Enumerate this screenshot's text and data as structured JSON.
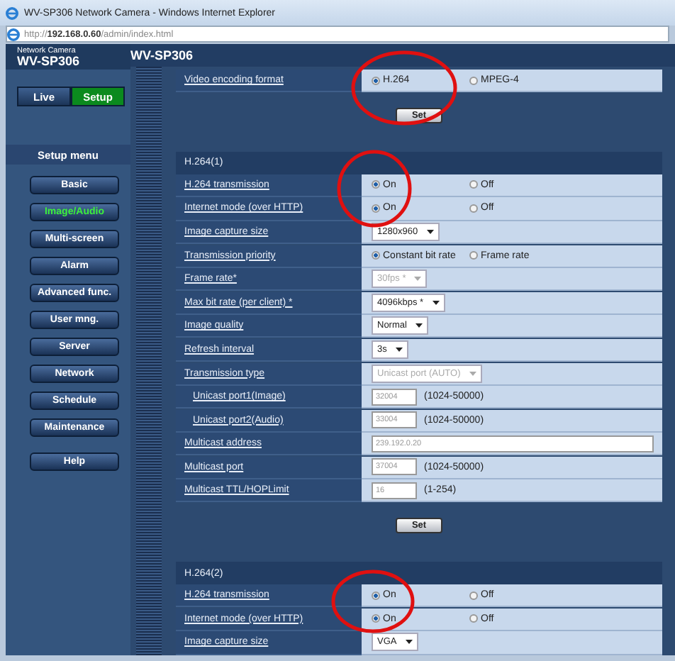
{
  "window": {
    "title": "WV-SP306 Network Camera - Windows Internet Explorer",
    "address": "http://**192.168.0.60**/admin/index.html"
  },
  "brand": {
    "subtitle": "Network Camera",
    "model": "WV-SP306"
  },
  "modes": [
    {
      "label": "Live",
      "selected": false
    },
    {
      "label": "Setup",
      "selected": true
    }
  ],
  "setup_menu": {
    "title": "Setup menu",
    "items": [
      {
        "label": "Basic",
        "selected": false
      },
      {
        "label": "Image/Audio",
        "selected": true
      },
      {
        "label": "Multi-screen",
        "selected": false
      },
      {
        "label": "Alarm",
        "selected": false
      },
      {
        "label": "Advanced func.",
        "selected": false
      },
      {
        "label": "User mng.",
        "selected": false
      },
      {
        "label": "Server",
        "selected": false
      },
      {
        "label": "Network",
        "selected": false
      },
      {
        "label": "Schedule",
        "selected": false
      },
      {
        "label": "Maintenance",
        "selected": false
      }
    ],
    "help_button": "Help"
  },
  "page_title": "WV-SP306",
  "sections": [
    {
      "rows": [
        {
          "label": "Video encoding format",
          "kind": "radio",
          "options": [
            {
              "label": "H.264",
              "selected": true
            },
            {
              "label": "MPEG-4",
              "selected": false
            }
          ]
        }
      ],
      "set_button": "Set"
    },
    {
      "title": "H.264(1)",
      "rows": [
        {
          "label": "H.264 transmission",
          "kind": "radio",
          "options": [
            {
              "label": "On",
              "selected": true
            },
            {
              "label": "Off",
              "selected": false
            }
          ]
        },
        {
          "label": "Internet mode (over HTTP)",
          "kind": "radio",
          "options": [
            {
              "label": "On",
              "selected": true
            },
            {
              "label": "Off",
              "selected": false
            }
          ]
        },
        {
          "label": "Image capture size",
          "kind": "select",
          "value": "1280x960",
          "disabled": false
        },
        {
          "label": "Transmission priority",
          "kind": "radio",
          "options": [
            {
              "label": "Constant bit rate",
              "selected": true
            },
            {
              "label": "Frame rate",
              "selected": false
            }
          ]
        },
        {
          "label": "Frame rate*",
          "kind": "select",
          "value": "30fps *",
          "disabled": true
        },
        {
          "label": "Max bit rate (per client) *",
          "kind": "select",
          "value": "4096kbps *",
          "disabled": false
        },
        {
          "label": "Image quality",
          "kind": "select",
          "value": "Normal",
          "disabled": false
        },
        {
          "label": "Refresh interval",
          "kind": "select",
          "value": "3s",
          "disabled": false
        },
        {
          "label": "Transmission type",
          "kind": "select",
          "value": "Unicast port (AUTO)",
          "disabled": true,
          "children": [
            {
              "label": "Unicast port1(Image)",
              "kind": "input",
              "value": "32004",
              "disabled": true,
              "suffix": "(1024-50000)"
            },
            {
              "label": "Unicast port2(Audio)",
              "kind": "input",
              "value": "33004",
              "disabled": true,
              "suffix": "(1024-50000)"
            }
          ]
        },
        {
          "label": "Multicast address",
          "kind": "input",
          "value": "239.192.0.20",
          "disabled": true,
          "wide": true
        },
        {
          "label": "Multicast port",
          "kind": "input",
          "value": "37004",
          "disabled": true,
          "suffix": "(1024-50000)"
        },
        {
          "label": "Multicast TTL/HOPLimit",
          "kind": "input",
          "value": "16",
          "disabled": true,
          "suffix": "(1-254)"
        }
      ],
      "set_button": "Set"
    },
    {
      "title": "H.264(2)",
      "rows": [
        {
          "label": "H.264 transmission",
          "kind": "radio",
          "options": [
            {
              "label": "On",
              "selected": true
            },
            {
              "label": "Off",
              "selected": false
            }
          ]
        },
        {
          "label": "Internet mode (over HTTP)",
          "kind": "radio",
          "options": [
            {
              "label": "On",
              "selected": true
            },
            {
              "label": "Off",
              "selected": false
            }
          ]
        },
        {
          "label": "Image capture size",
          "kind": "select",
          "value": "VGA",
          "disabled": false
        }
      ]
    }
  ]
}
